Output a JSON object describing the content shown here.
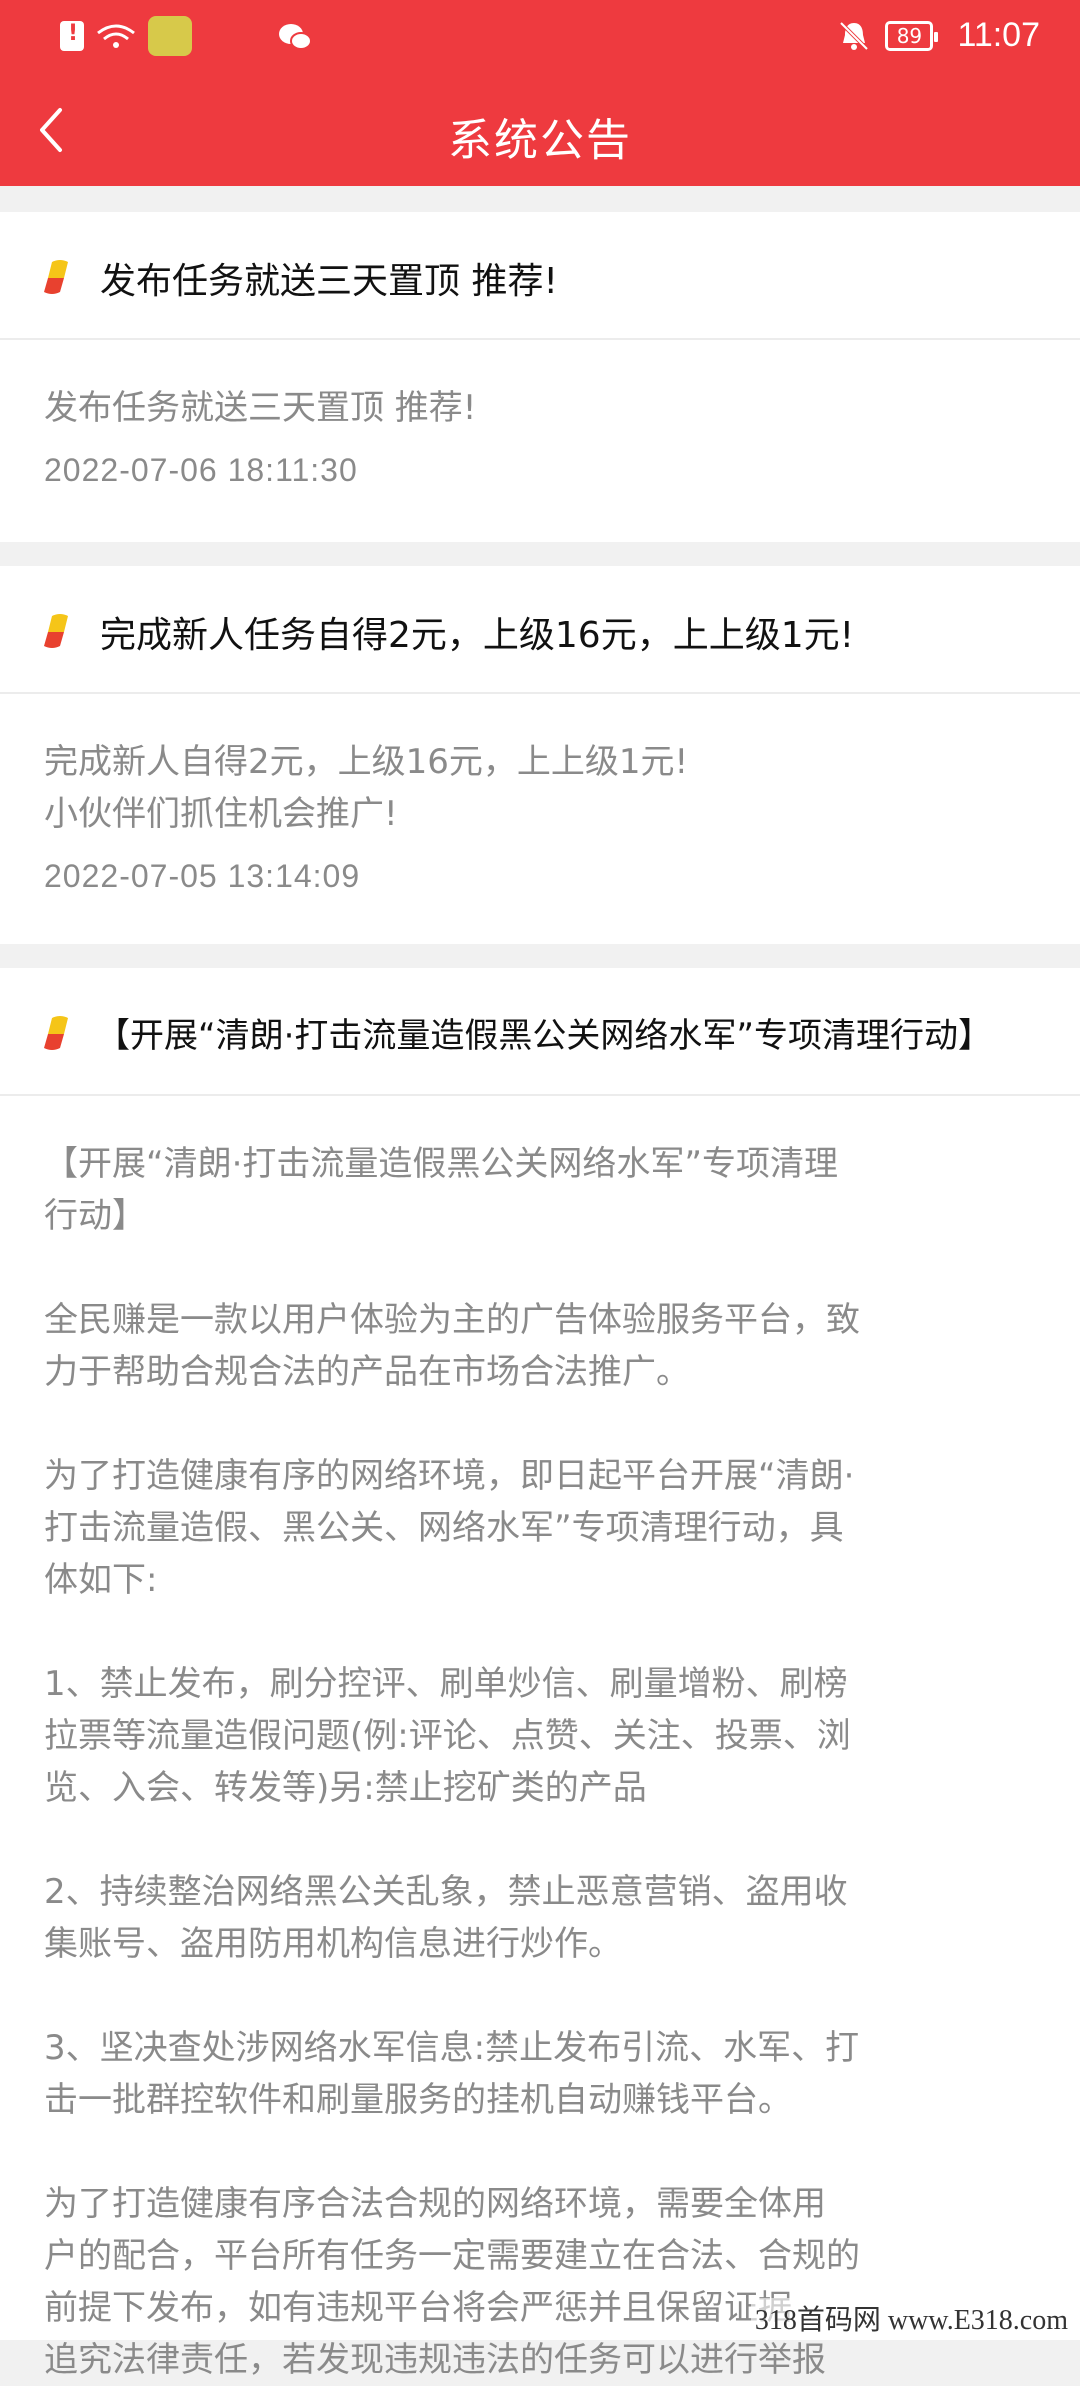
{
  "status_bar": {
    "time": "11:07",
    "battery": "89",
    "icons": [
      "sim-alert-icon",
      "wifi-icon",
      "app-icon",
      "wechat-icon",
      "mute-bell-icon",
      "battery-icon"
    ]
  },
  "header": {
    "title": "系统公告",
    "back_icon": "chevron-left-icon"
  },
  "colors": {
    "header_bg": "#ee3a3f",
    "flag_top": "#f5c518",
    "flag_bottom": "#e8412f",
    "body_text": "#8a8a8a"
  },
  "notices": [
    {
      "title": "发布任务就送三天置顶 推荐!",
      "body": "发布任务就送三天置顶 推荐!",
      "date": "2022-07-06 18:11:30"
    },
    {
      "title": "完成新人任务自得2元，上级16元，上上级1元!",
      "body": "完成新人自得2元，上级16元，上上级1元!\n小伙伴们抓住机会推广!",
      "date": "2022-07-05 13:14:09"
    },
    {
      "title": "【开展“清朗·打击流量造假黑公关网络水军”专项清理行动】",
      "body": "【开展“清朗·打击流量造假黑公关网络水军”专项清理\n行动】\n\n全民赚是一款以用户体验为主的广告体验服务平台，致\n力于帮助合规合法的产品在市场合法推广。\n\n为了打造健康有序的网络环境，即日起平台开展“清朗·\n打击流量造假、黑公关、网络水军”专项清理行动，具\n体如下:\n\n1、禁止发布，刷分控评、刷单炒信、刷量增粉、刷榜\n拉票等流量造假问题(例:评论、点赞、关注、投票、浏\n览、入会、转发等)另:禁止挖矿类的产品\n\n2、持续整治网络黑公关乱象，禁止恶意营销、盗用收\n集账号、盗用防用机构信息进行炒作。\n\n3、坚决查处涉网络水军信息:禁止发布引流、水军、打\n击一批群控软件和刷量服务的挂机自动赚钱平台。\n\n为了打造健康有序合法合规的网络环境，需要全体用\n户的配合，平台所有任务一定需要建立在合法、合规的\n前提下发布，如有违规平台将会严惩并且保留证据\n追究法律责任，若发现违规违法的任务可以进行举报"
    }
  ],
  "watermark": "318首码网 www.E318.com"
}
